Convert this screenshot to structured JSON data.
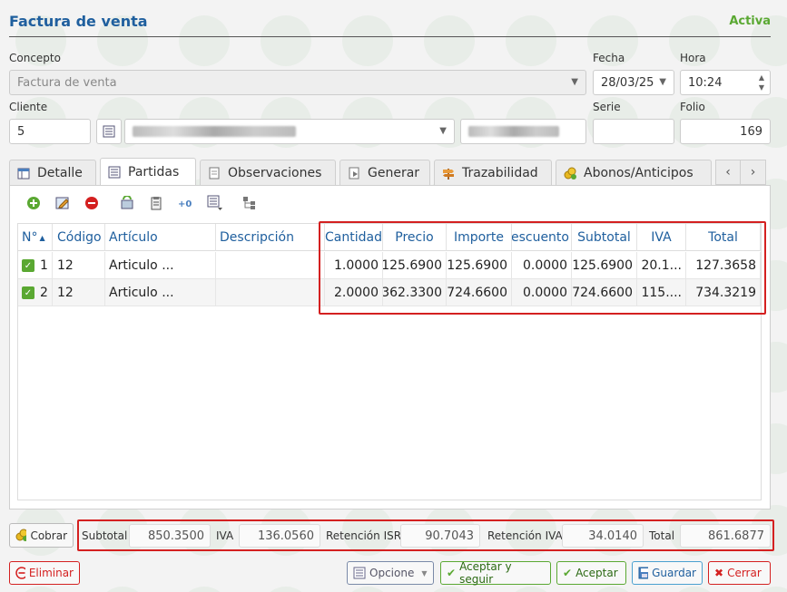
{
  "header": {
    "title": "Factura de venta",
    "status": "Activa"
  },
  "form": {
    "concepto_label": "Concepto",
    "concepto_value": "Factura de venta",
    "fecha_label": "Fecha",
    "fecha_value": "28/03/25",
    "hora_label": "Hora",
    "hora_value": "10:24",
    "cliente_label": "Cliente",
    "cliente_value": "5",
    "serie_label": "Serie",
    "serie_value": "",
    "folio_label": "Folio",
    "folio_value": "169"
  },
  "tabs": [
    {
      "label": "Detalle",
      "icon": "table-icon"
    },
    {
      "label": "Partidas",
      "icon": "list-icon",
      "active": true
    },
    {
      "label": "Observaciones",
      "icon": "document-icon"
    },
    {
      "label": "Generar",
      "icon": "generate-icon"
    },
    {
      "label": "Trazabilidad",
      "icon": "signpost-icon"
    },
    {
      "label": "Abonos/Anticipos",
      "icon": "coins-icon"
    }
  ],
  "toolbar": [
    "add-icon",
    "edit-icon",
    "remove-icon",
    "refresh-icon",
    "clipboard-icon",
    "number-icon",
    "list-dropdown-icon",
    "tree-icon"
  ],
  "grid": {
    "columns": [
      "N°",
      "Código",
      "Artículo",
      "Descripción",
      "Cantidad",
      "Precio",
      "Importe",
      "Descuento",
      "Subtotal",
      "IVA",
      "Total"
    ],
    "rows": [
      {
        "n": "1",
        "codigo": "12",
        "articulo": "Articulo ...",
        "descripcion": "",
        "cantidad": "1.0000",
        "precio": "125.6900",
        "importe": "125.6900",
        "descuento": "0.0000",
        "subtotal": "125.6900",
        "iva": "20.1...",
        "total": "127.3658"
      },
      {
        "n": "2",
        "codigo": "12",
        "articulo": "Articulo ...",
        "descripcion": "",
        "cantidad": "2.0000",
        "precio": "362.3300",
        "importe": "724.6600",
        "descuento": "0.0000",
        "subtotal": "724.6600",
        "iva": "115....",
        "total": "734.3219"
      }
    ]
  },
  "totals": {
    "cobrar_label": "Cobrar",
    "subtotal_label": "Subtotal",
    "subtotal": "850.3500",
    "iva_label": "IVA",
    "iva": "136.0560",
    "ret_isr_label": "Retención ISR",
    "ret_isr": "90.7043",
    "ret_iva_label": "Retención IVA",
    "ret_iva": "34.0140",
    "total_label": "Total",
    "total": "861.6877"
  },
  "footer": {
    "eliminar": "Eliminar",
    "opcione": "Opcione",
    "aceptar_seguir": "Aceptar y seguir",
    "aceptar": "Aceptar",
    "guardar": "Guardar",
    "cerrar": "Cerrar"
  },
  "colors": {
    "accent": "#1f5f9e",
    "status": "#5aa832",
    "highlight": "#d42020",
    "danger": "#d42020"
  }
}
